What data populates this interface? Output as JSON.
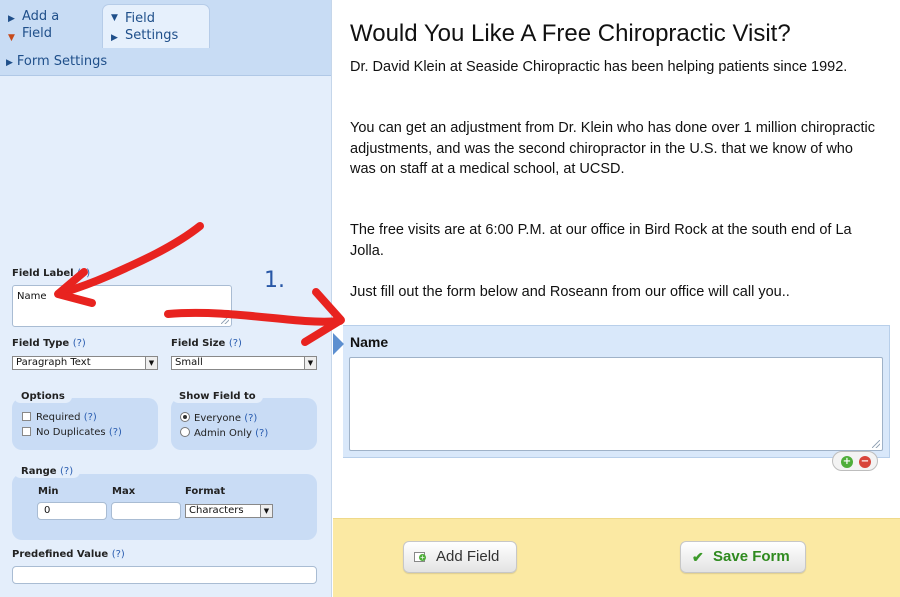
{
  "sidebar": {
    "tabs": {
      "add_field": "Add a\nField",
      "field_settings": "Field\nSettings"
    },
    "form_settings_label": "Form Settings",
    "field_label": {
      "label": "Field Label",
      "help": "(?)",
      "value": "Name"
    },
    "field_type": {
      "label": "Field Type",
      "help": "(?)",
      "value": "Paragraph Text"
    },
    "field_size": {
      "label": "Field Size",
      "help": "(?)",
      "value": "Small"
    },
    "options": {
      "title": "Options",
      "required": {
        "label": "Required",
        "help": "(?)"
      },
      "no_duplicates": {
        "label": "No Duplicates",
        "help": "(?)"
      }
    },
    "show_field_to": {
      "title": "Show Field to",
      "everyone": {
        "label": "Everyone",
        "help": "(?)",
        "selected": true
      },
      "admin_only": {
        "label": "Admin Only",
        "help": "(?)",
        "selected": false
      }
    },
    "range": {
      "title": "Range",
      "help": "(?)",
      "min_label": "Min",
      "max_label": "Max",
      "format_label": "Format",
      "min_value": "0",
      "max_value": "",
      "format_value": "Characters"
    },
    "predefined_value": {
      "label": "Predefined Value",
      "help": "(?)",
      "value": ""
    }
  },
  "form": {
    "title": "Would You Like A Free Chiropractic Visit?",
    "paragraphs": [
      "Dr. David Klein at Seaside Chiropractic has been helping patients since 1992.",
      "You can get an adjustment from Dr. Klein who has done over 1 million chiropractic adjustments, and was the second chiropractor in the U.S. that we know of who was on staff at a medical school, at UCSD.",
      "The free visits are at 6:00 P.M. at our office in Bird Rock at the south end of La Jolla.",
      "Just fill out the form below and Roseann from our office will call you.."
    ],
    "field": {
      "name": "Name",
      "value": ""
    },
    "add_symbol": "+",
    "remove_symbol": "−"
  },
  "footer": {
    "add_field_label": "Add Field",
    "save_form_label": "Save Form",
    "save_icon": "✔"
  },
  "annotation": {
    "step_number": "1.",
    "arrow_color": "#e8231f",
    "step_color": "#2857a6"
  },
  "colors": {
    "sidebar_bg": "#e4eefb",
    "tab_bar_bg": "#c8dcf4",
    "field_row_bg": "#d9e8fa",
    "footer_bg": "#fbe9a3",
    "save_green": "#2f8a1f"
  }
}
